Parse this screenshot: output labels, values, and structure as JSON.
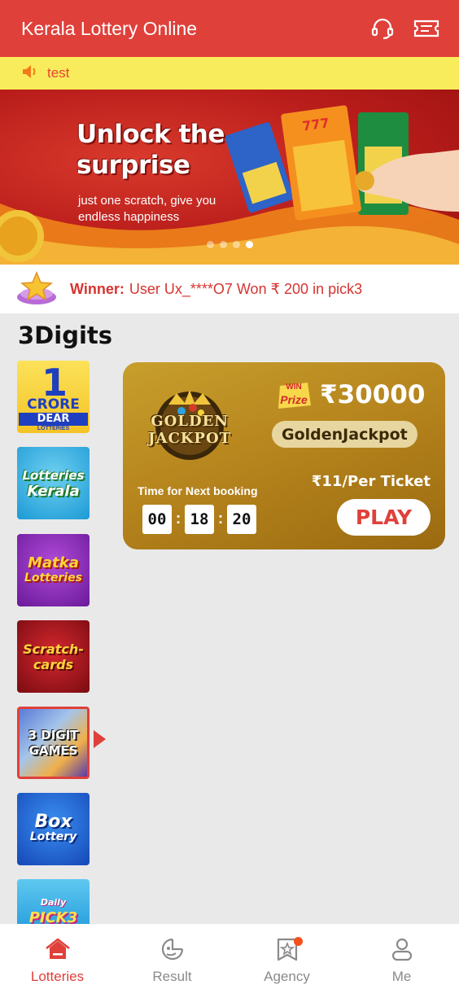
{
  "header": {
    "title": "Kerala Lottery Online",
    "support_icon": "headset-icon",
    "ticket_icon": "ticket-icon"
  },
  "notice": {
    "icon": "speaker-icon",
    "text": "test"
  },
  "banner": {
    "headline": "Unlock the surprise",
    "subtitle": "just one scratch, give you endless happiness",
    "slides": 4,
    "active_slide": 4
  },
  "winner": {
    "label": "Winner:",
    "message": "User Ux_****O7 Won ₹ 200 in pick3"
  },
  "section": {
    "title": "3Digits"
  },
  "categories": [
    {
      "name": "1 CRORE DEAR LOTTERIES",
      "top": "1",
      "mid": "CRORE",
      "bottom": "DEAR",
      "small": "LOTTERIES"
    },
    {
      "name": "Lotteries Kerala",
      "line1": "Lotteries",
      "line2": "Kerala"
    },
    {
      "name": "Matka Lotteries",
      "line1": "Matka",
      "line2": "Lotteries"
    },
    {
      "name": "Scratch-cards",
      "line1": "Scratch-",
      "line2": "cards"
    },
    {
      "name": "3 DIGIT GAMES",
      "line1": "3 DIGIT",
      "line2": "GAMES",
      "selected": true
    },
    {
      "name": "Box Lottery",
      "line1": "Box",
      "line2": "Lottery"
    },
    {
      "name": "Daily PICK3",
      "line1": "Daily",
      "line2": "PICK3"
    }
  ],
  "game_card": {
    "logo_text": "GOLDEN JACKPOT",
    "prize_badge_line1": "WIN",
    "prize_badge_line2": "Prize",
    "prize_amount": "₹30000",
    "game_name": "GoldenJackpot",
    "timer_label": "Time for Next booking",
    "timer": {
      "hh": "00",
      "mm": "18",
      "ss": "20",
      "sep": ":"
    },
    "price": "₹11/Per Ticket",
    "play_label": "PLAY"
  },
  "tabbar": {
    "tabs": [
      {
        "label": "Lotteries",
        "icon": "home-icon",
        "active": true
      },
      {
        "label": "Result",
        "icon": "result-icon",
        "active": false
      },
      {
        "label": "Agency",
        "icon": "agency-icon",
        "active": false,
        "badge": true
      },
      {
        "label": "Me",
        "icon": "user-icon",
        "active": false
      }
    ]
  },
  "colors": {
    "primary": "#e0403a",
    "notice_bg": "#f9ec5c",
    "gold": "#b7861e"
  }
}
